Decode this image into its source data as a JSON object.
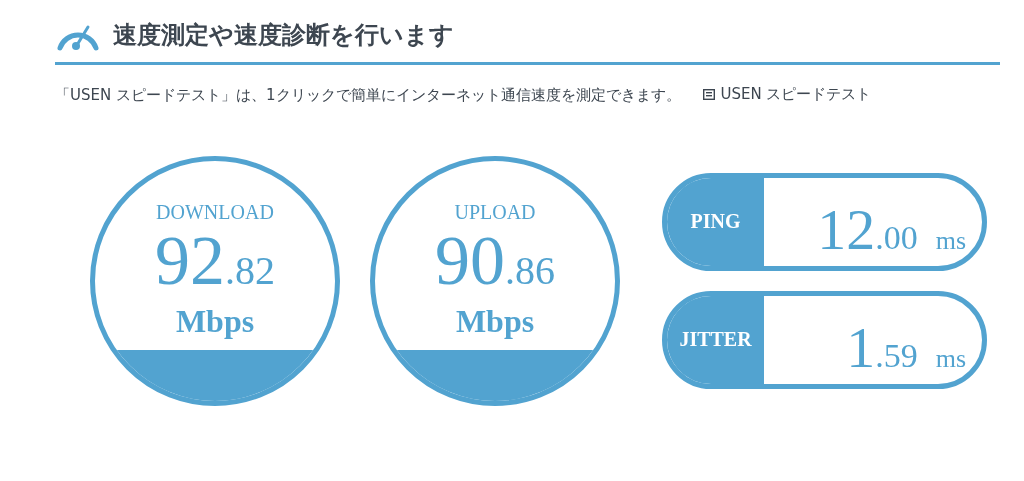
{
  "heading": "速度測定や速度診断を行います",
  "description": {
    "text": "「USEN スピードテスト」は、1クリックで簡単にインターネット通信速度を測定できます。",
    "link": "USEN スピードテスト"
  },
  "gauges": [
    {
      "label": "DOWNLOAD",
      "integer": "92",
      "decimal": ".82",
      "unit": "Mbps"
    },
    {
      "label": "UPLOAD",
      "integer": "90",
      "decimal": ".86",
      "unit": "Mbps"
    }
  ],
  "metrics": [
    {
      "label": "PING",
      "integer": "12",
      "decimal": ".00",
      "unit": "ms"
    },
    {
      "label": "JITTER",
      "integer": "1",
      "decimal": ".59",
      "unit": "ms"
    }
  ]
}
